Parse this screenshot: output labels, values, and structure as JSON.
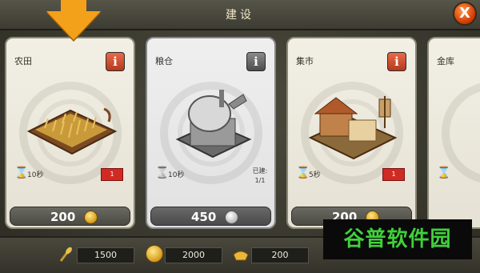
{
  "window": {
    "title": "建设",
    "close_label": "X"
  },
  "cards": [
    {
      "name": "农田",
      "info_icon": "i",
      "time": "10秒",
      "badge": "1",
      "price": "200",
      "currency": "gold-coin"
    },
    {
      "name": "粮仓",
      "info_icon": "i",
      "time": "10秒",
      "built_label": "已建:",
      "built_value": "1/1",
      "price": "450",
      "currency": "silver-coin"
    },
    {
      "name": "集市",
      "info_icon": "i",
      "time": "5秒",
      "badge": "1",
      "price": "200",
      "currency": "gold-coin"
    },
    {
      "name": "金库",
      "info_icon": "i",
      "time": "",
      "badge": ""
    }
  ],
  "resources": [
    {
      "icon": "grain-icon",
      "value": "1500"
    },
    {
      "icon": "gold-coin-icon",
      "value": "2000"
    },
    {
      "icon": "ingot-icon",
      "value": "200"
    }
  ],
  "watermark": "谷普软件园",
  "colors": {
    "accent_red": "#d02a22",
    "arrow_orange": "#f3a11a",
    "watermark_green": "#3fd13a"
  }
}
